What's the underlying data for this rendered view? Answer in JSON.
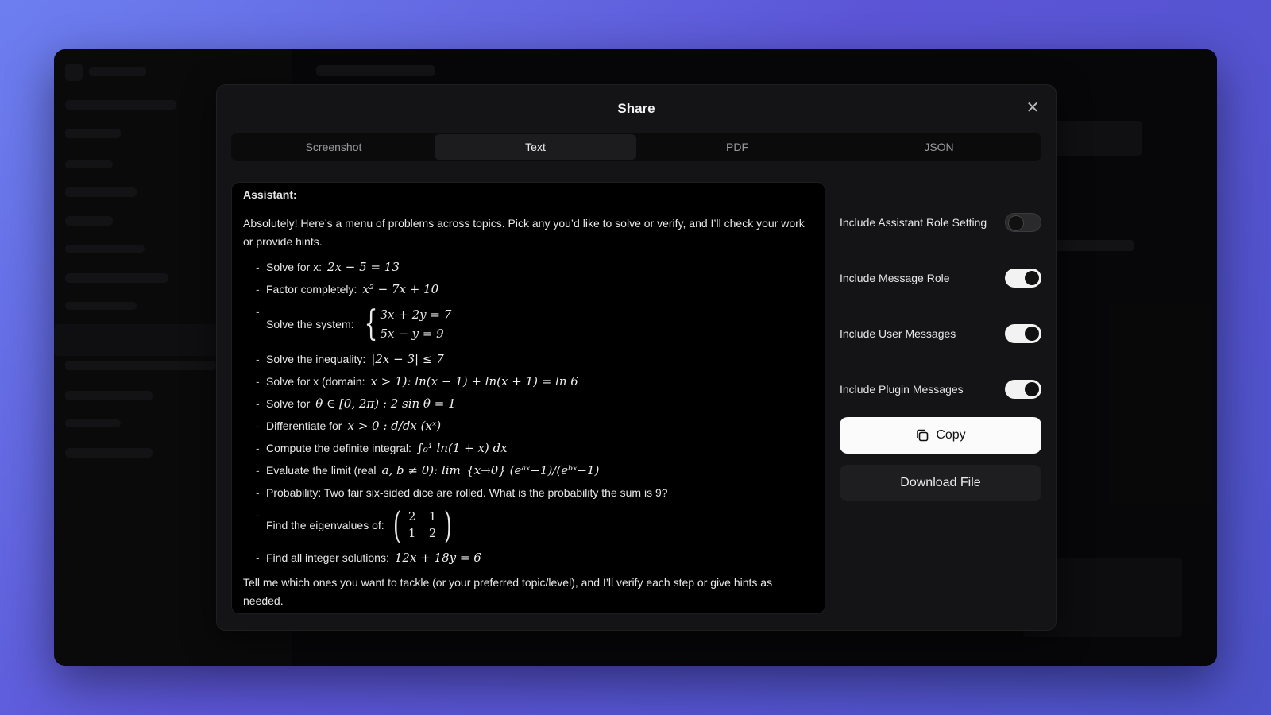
{
  "dialog": {
    "title": "Share",
    "tabs": [
      {
        "label": "Screenshot",
        "active": false
      },
      {
        "label": "Text",
        "active": true
      },
      {
        "label": "PDF",
        "active": false
      },
      {
        "label": "JSON",
        "active": false
      }
    ]
  },
  "preview": {
    "role": "Assistant:",
    "intro": "Absolutely! Here’s a menu of problems across topics. Pick any you’d like to solve or verify, and I’ll check your work or provide hints.",
    "items": [
      {
        "label": "Solve for x:",
        "math": "2x − 5 = 13"
      },
      {
        "label": "Factor completely:",
        "math": "x² − 7x + 10"
      },
      {
        "label": "Solve the system:",
        "system": [
          "3x + 2y = 7",
          "5x − y = 9"
        ]
      },
      {
        "label": "Solve the inequality:",
        "math": "|2x − 3| ≤ 7"
      },
      {
        "label": "Solve for x (domain:",
        "math": "x > 1): ln(x − 1) + ln(x + 1) = ln 6"
      },
      {
        "label": "Solve for",
        "math": "θ ∈ [0, 2π) :  2 sin θ = 1"
      },
      {
        "label": "Differentiate for",
        "math": "x > 0 :  d/dx (xˣ)"
      },
      {
        "label": "Compute the definite integral:",
        "math": "∫₀¹ ln(1 + x) dx"
      },
      {
        "label": "Evaluate the limit (real",
        "math": "a, b ≠ 0): lim_{x→0} (eᵃˣ−1)/(eᵇˣ−1)"
      },
      {
        "label": "Probability: Two fair six-sided dice are rolled. What is the probability the sum is 9?",
        "math": ""
      },
      {
        "label": "Find the eigenvalues of:",
        "matrix": [
          "2",
          "1",
          "1",
          "2"
        ]
      },
      {
        "label": "Find all integer solutions:",
        "math": "12x + 18y = 6"
      }
    ],
    "outro": "Tell me which ones you want to tackle (or your preferred topic/level), and I’ll verify each step or give hints as needed."
  },
  "options": [
    {
      "label": "Include Assistant Role Setting",
      "on": false
    },
    {
      "label": "Include Message Role",
      "on": true
    },
    {
      "label": "Include User Messages",
      "on": true
    },
    {
      "label": "Include Plugin Messages",
      "on": true
    }
  ],
  "buttons": {
    "copy": "Copy",
    "download": "Download File"
  },
  "colors": {
    "background_gradient_start": "#6d7ff0",
    "background_gradient_end": "#4d52c8",
    "dialog_bg": "#141416",
    "toggle_on": "#f2f2f2",
    "toggle_off": "#2a2a2d"
  }
}
